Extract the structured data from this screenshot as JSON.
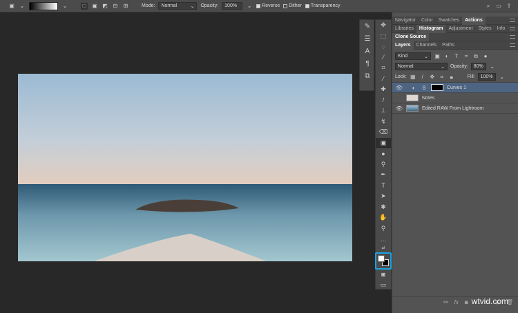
{
  "options_bar": {
    "mode_label": "Mode:",
    "mode_value": "Normal",
    "opacity_label": "Opacity:",
    "opacity_value": "100%",
    "reverse_label": "Reverse",
    "dither_label": "Dither",
    "transparency_label": "Transparency",
    "reverse_checked": true,
    "dither_checked": false,
    "transparency_checked": true
  },
  "panels": {
    "row1": [
      "Navigator",
      "Color",
      "Swatches",
      "Actions"
    ],
    "row2": [
      "Libraries",
      "Histogram",
      "Adjustment",
      "Styles",
      "Info"
    ],
    "row3": [
      "Clone Source"
    ],
    "row4": [
      "Layers",
      "Channels",
      "Paths"
    ]
  },
  "layers_panel": {
    "filter_kind": "Kind",
    "blend_mode": "Normal",
    "opacity_label": "Opacity:",
    "opacity_value": "80%",
    "lock_label": "Lock:",
    "fill_label": "Fill:",
    "fill_value": "100%",
    "layers": [
      {
        "name": "Curves 1",
        "visible": true,
        "selected": true
      },
      {
        "name": "Notes",
        "visible": false,
        "selected": false
      },
      {
        "name": "Edited RAW From Lightroom",
        "visible": true,
        "selected": false
      }
    ]
  },
  "watermark": "wtvid.com",
  "colors": {
    "highlight": "#1aa3e0",
    "selected_layer": "#4d6582"
  }
}
